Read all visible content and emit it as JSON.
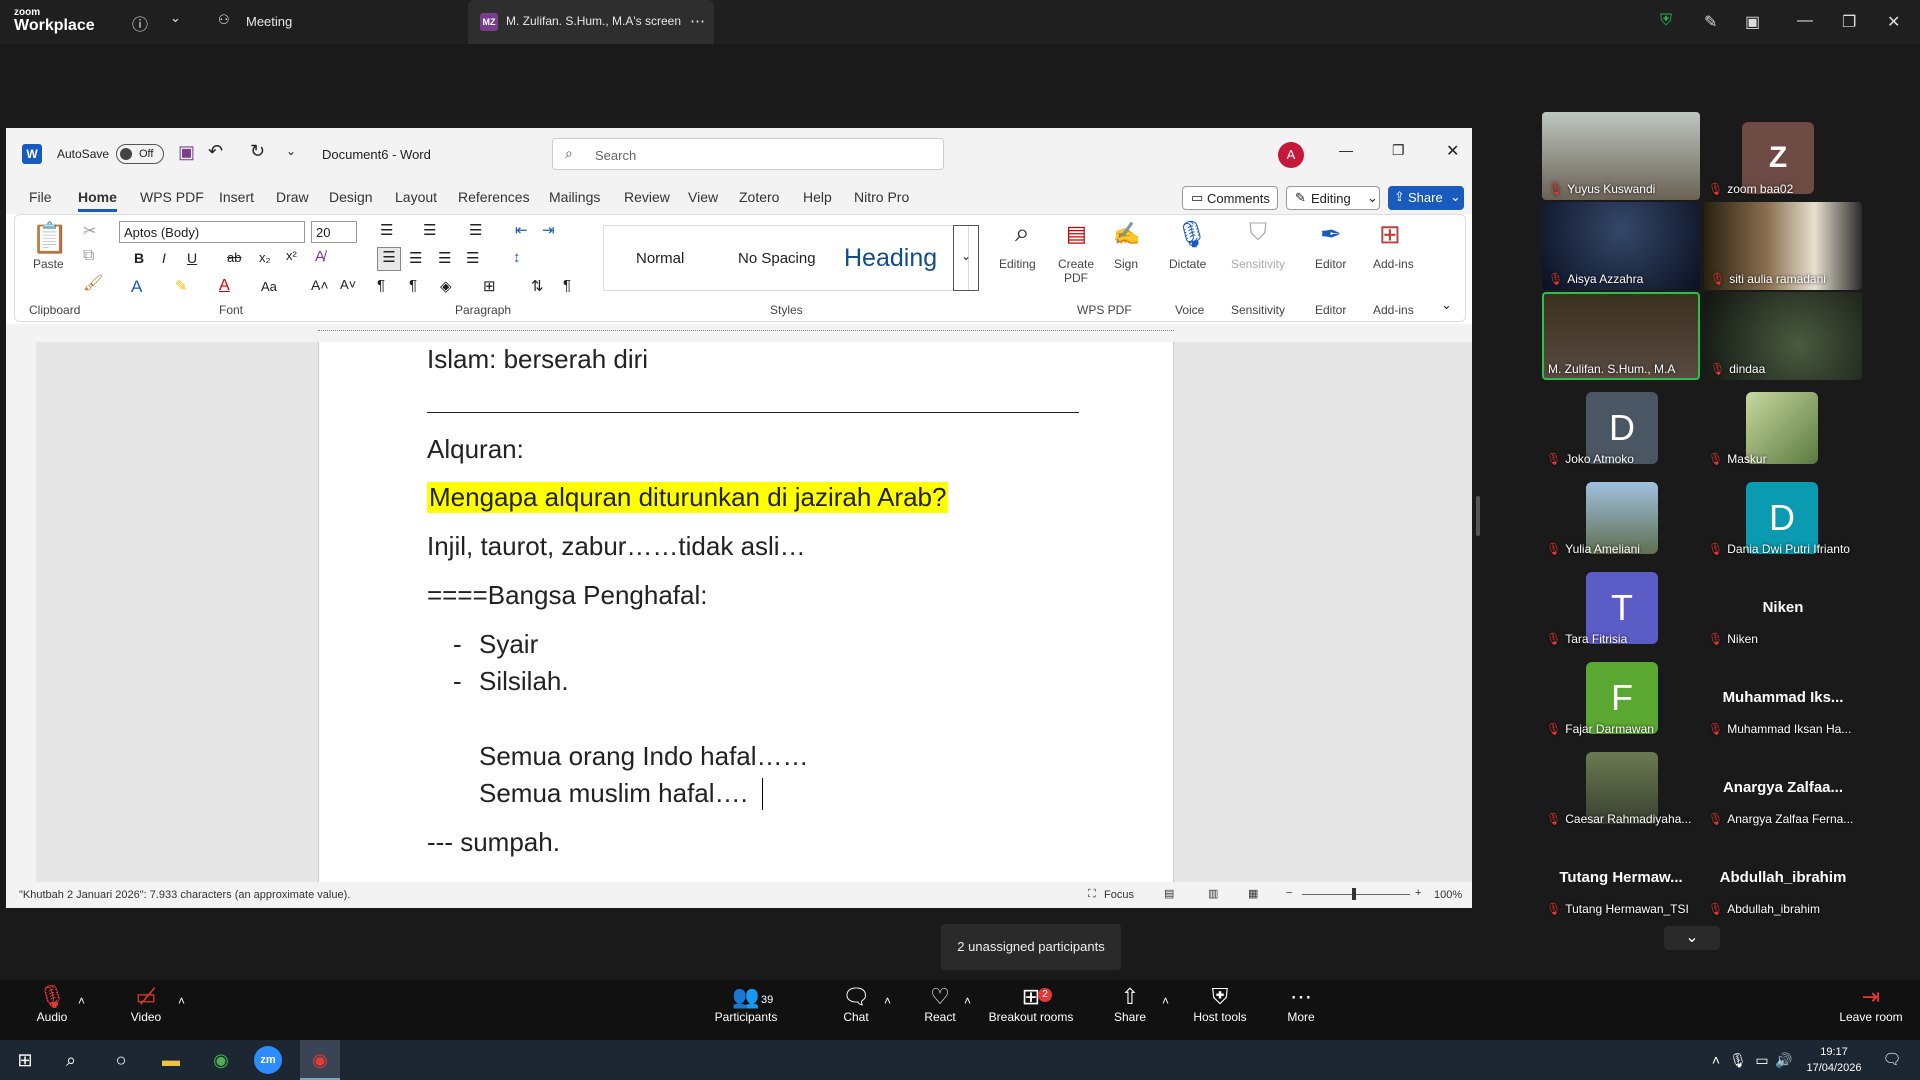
{
  "zoom": {
    "logo_small": "zoom",
    "logo_big": "Workplace",
    "meeting_tab": "Meeting",
    "screen_tab_initials": "MZ",
    "screen_tab": "M. Zulifan. S.Hum., M.A's screen"
  },
  "word": {
    "autosave": "AutoSave",
    "autosave_state": "Off",
    "doc_title": "Document6",
    "app": "Word",
    "search_placeholder": "Search",
    "account_initial": "A",
    "tabs": [
      "File",
      "Home",
      "WPS PDF",
      "Insert",
      "Draw",
      "Design",
      "Layout",
      "References",
      "Mailings",
      "Review",
      "View",
      "Zotero",
      "Help",
      "Nitro Pro"
    ],
    "comments": "Comments",
    "editing_mode": "Editing",
    "share": "Share",
    "font_name": "Aptos (Body)",
    "font_size": "20",
    "paste": "Paste",
    "styles": [
      "Normal",
      "No Spacing",
      "Heading"
    ],
    "ribbon_buttons": {
      "editing": "Editing",
      "create_pdf": "Create PDF",
      "sign": "Sign",
      "dictate": "Dictate",
      "sensitivity": "Sensitivity",
      "editor": "Editor",
      "addins": "Add-ins"
    },
    "groups": [
      "Clipboard",
      "Font",
      "Paragraph",
      "Styles",
      "WPS PDF",
      "Voice",
      "Sensitivity",
      "Editor",
      "Add-ins"
    ],
    "doc_lines": {
      "l1": "Islam: berserah diri",
      "l2": "Alquran:",
      "l3": "Mengapa alquran diturunkan di jazirah Arab?",
      "l4": "Injil, taurot, zabur……tidak asli…",
      "l5": "====Bangsa Penghafal:",
      "l6": "Syair",
      "l7": "Silsilah.",
      "l8": "Semua orang Indo hafal……",
      "l9": "Semua muslim hafal….",
      "l10": "--- sumpah."
    },
    "highlight_color": "#ffff00",
    "status_text": "\"Khutbah 2 Januari 2026\": 7.933 characters (an approximate value).",
    "focus": "Focus",
    "zoom_level": "100%"
  },
  "participants": [
    {
      "name": "Yuyus Kuswandi",
      "type": "video"
    },
    {
      "name": "zoom baa02",
      "type": "avatar",
      "initial": "Z",
      "color": "#6e4a44"
    },
    {
      "name": "Aisya Azzahra",
      "type": "video"
    },
    {
      "name": "siti aulia ramadani",
      "type": "video"
    },
    {
      "name": "M. Zulifan. S.Hum., M.A",
      "type": "video"
    },
    {
      "name": "dindaa",
      "type": "video"
    },
    {
      "name": "Joko Atmoko",
      "type": "avatar",
      "initial": "D",
      "color": "#4a5663"
    },
    {
      "name": "Maskur",
      "type": "video"
    },
    {
      "name": "Yulia Ameliani",
      "type": "video"
    },
    {
      "name": "Dania Dwi Putri Ifrianto",
      "type": "avatar",
      "initial": "D",
      "color": "#0a9bb0"
    },
    {
      "name": "Tara Fitrisia",
      "type": "avatar",
      "initial": "T",
      "color": "#5c5cc6"
    },
    {
      "name": "Niken",
      "type": "text",
      "display": "Niken"
    },
    {
      "name": "Fajar Darmawan",
      "type": "avatar",
      "initial": "F",
      "color": "#5aa832"
    },
    {
      "name": "Muhammad Iksan Ha...",
      "type": "text",
      "display": "Muhammad  Iks..."
    },
    {
      "name": "Caesar Rahmadiyaha...",
      "type": "video"
    },
    {
      "name": "Anargya Zalfaa Ferna...",
      "type": "text",
      "display": "Anargya  Zalfaa..."
    },
    {
      "name": "Tutang Hermawan_TSI",
      "type": "text",
      "display": "Tutang  Hermaw..."
    },
    {
      "name": "Abdullah_ibrahim",
      "type": "text",
      "display": "Abdullah_ibrahim"
    }
  ],
  "controls": {
    "audio": "Audio",
    "video": "Video",
    "participants": "Participants",
    "participant_count": "39",
    "chat": "Chat",
    "react": "React",
    "breakout": "Breakout rooms",
    "breakout_badge": "2",
    "share": "Share",
    "host_tools": "Host tools",
    "more": "More",
    "leave": "Leave room",
    "tooltip": "2 unassigned participants"
  },
  "taskbar": {
    "time": "19:17",
    "date": "17/04/2026"
  }
}
